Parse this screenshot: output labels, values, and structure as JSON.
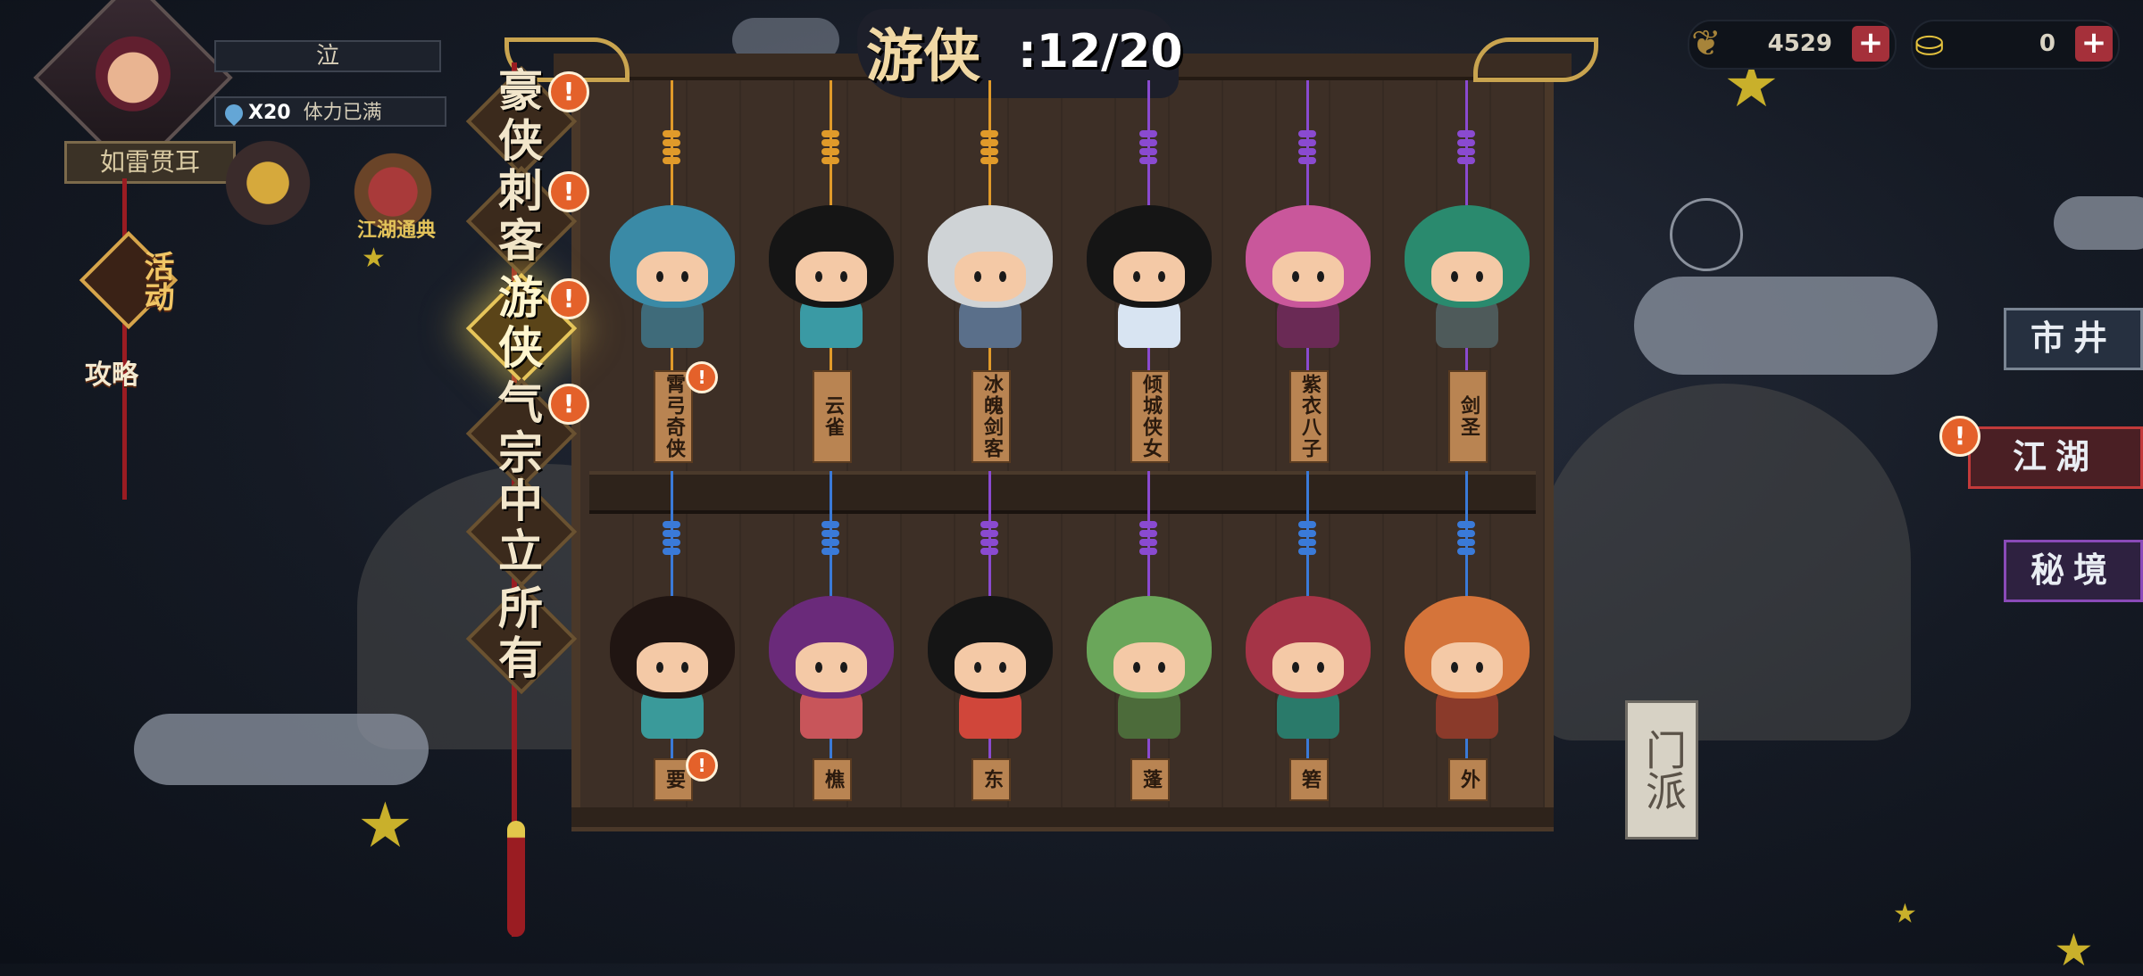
{
  "player": {
    "name": "泣",
    "stamina_count": "X20",
    "stamina_status": "体力已满",
    "title": "如雷贯耳"
  },
  "left_menu": {
    "guide_label": "江湖通典",
    "activity_label": "活动",
    "strategy_label": "攻略"
  },
  "currency": {
    "coins": "4529",
    "ingots": "0",
    "plus_label": "+"
  },
  "right_menu": [
    "市井",
    "江湖",
    "秘境"
  ],
  "map_tags": [
    "门派"
  ],
  "header": {
    "title": "游侠",
    "collected": "12/20"
  },
  "tabs": [
    {
      "label": "豪侠",
      "alert": true
    },
    {
      "label": "刺客",
      "alert": true
    },
    {
      "label": "游侠",
      "alert": true,
      "active": true
    },
    {
      "label": "气宗",
      "alert": true
    },
    {
      "label": "中立",
      "alert": false
    },
    {
      "label": "所有",
      "alert": false
    }
  ],
  "alert_mark": "!",
  "characters_row1": [
    {
      "name": "霄弓奇侠",
      "alert": true
    },
    {
      "name": "云雀",
      "alert": false
    },
    {
      "name": "冰魄剑客",
      "alert": false
    },
    {
      "name": "倾城侠女",
      "alert": false
    },
    {
      "name": "紫衣八子",
      "alert": false
    },
    {
      "name": "剑圣",
      "alert": false
    }
  ],
  "characters_row2": [
    {
      "name": "要",
      "alert": true
    },
    {
      "name": "樵",
      "alert": false
    },
    {
      "name": "东",
      "alert": false
    },
    {
      "name": "蓬",
      "alert": false
    },
    {
      "name": "箬",
      "alert": false
    },
    {
      "name": "外",
      "alert": false
    }
  ],
  "colors": {
    "accent_gold": "#e6c55a",
    "alert_orange": "#e4612a",
    "currency_plus": "#a5303a",
    "wood": "#3d2f26"
  }
}
